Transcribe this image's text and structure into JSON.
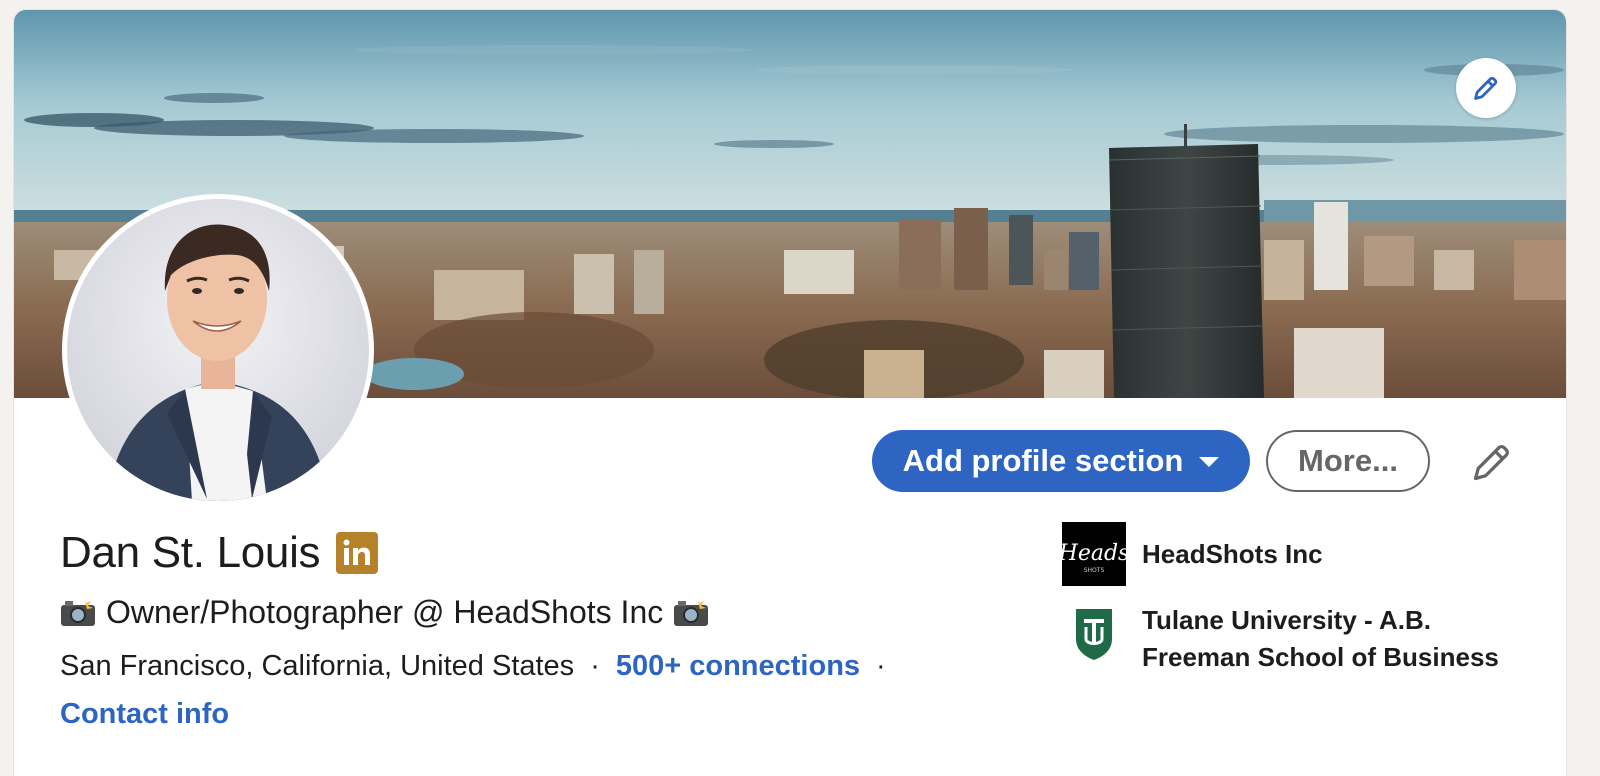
{
  "profile": {
    "name": "Dan St. Louis",
    "headline": "Owner/Photographer @ HeadShots Inc",
    "location": "San Francisco, California, United States",
    "separator": "·",
    "connections": "500+ connections",
    "contact_info": "Contact info"
  },
  "actions": {
    "add_section_label": "Add profile section",
    "more_label": "More..."
  },
  "sidebar": {
    "company": {
      "name": "HeadShots Inc",
      "logo_text": "Heads",
      "logo_subtext": "SHOTS"
    },
    "school": {
      "name_line1": "Tulane University - A.B.",
      "name_line2": "Freeman School of Business"
    }
  },
  "icons": {
    "banner_edit": "pencil-icon",
    "profile_edit": "pencil-icon",
    "badge": "linkedin-icon",
    "headline_emoji": "camera-flash-icon"
  },
  "colors": {
    "accent": "#2e65c2",
    "badge": "#b58229",
    "school": "#1f6b47"
  }
}
